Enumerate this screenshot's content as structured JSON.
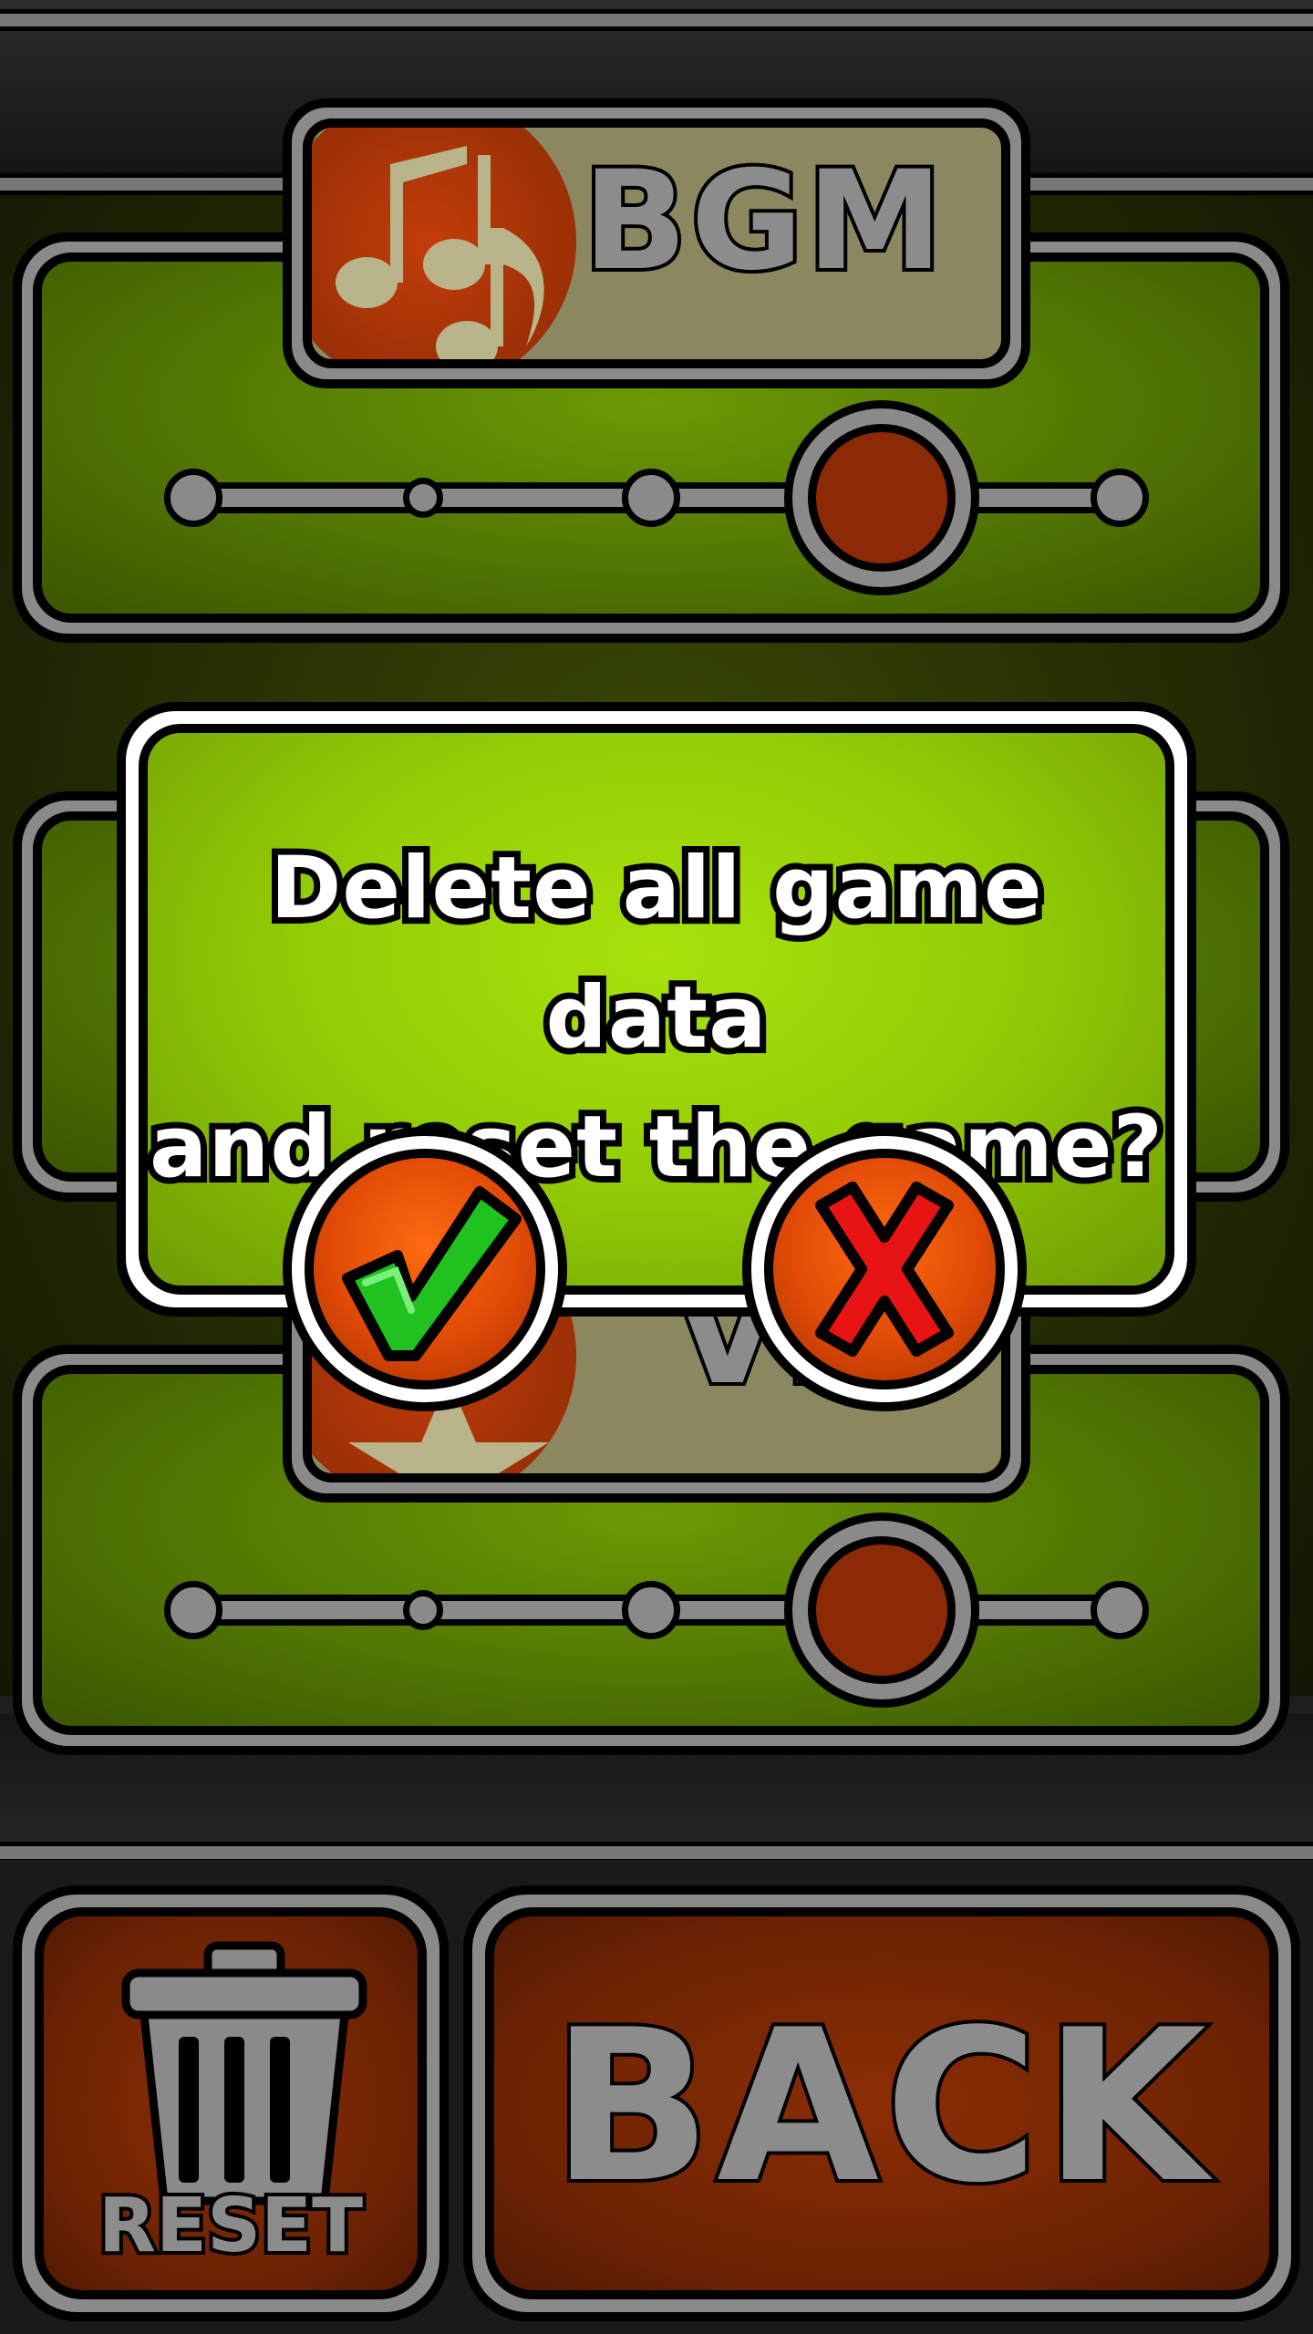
{
  "settings": {
    "bgm": {
      "label": "BGM",
      "level": 4,
      "levels": 5
    },
    "vib": {
      "label": "VIB",
      "level": 4,
      "levels": 5
    }
  },
  "buttons": {
    "reset_label": "RESET",
    "back_label": "BACK"
  },
  "dialog": {
    "line1": "Delete all game data",
    "line2": "and reset the game?",
    "confirm_icon": "checkmark-icon",
    "cancel_icon": "cross-icon"
  },
  "colors": {
    "panel_green": "#5a8504",
    "dialog_green": "#a8e20a",
    "button_orange": "#e04a06",
    "back_brown": "#8c2e05",
    "frame_gray": "#8a8a8a"
  }
}
